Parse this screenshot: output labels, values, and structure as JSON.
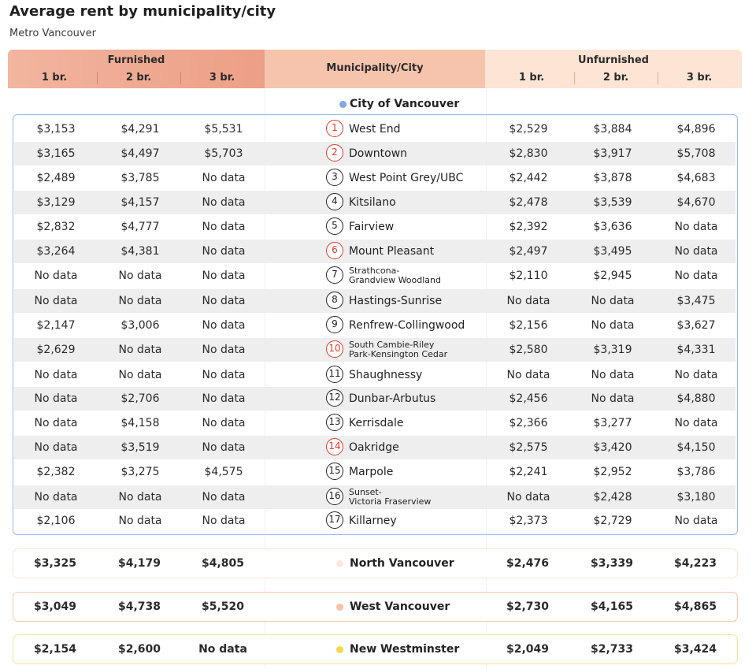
{
  "title": "Average rent by municipality/city",
  "subtitle": "Metro Vancouver",
  "header": {
    "furnished": "Furnished",
    "municipality": "Municipality/City",
    "unfurnished": "Unfurnished",
    "br1": "1 br.",
    "br2": "2 br.",
    "br3": "3 br."
  },
  "city_group": {
    "name": "City of Vancouver",
    "dot_color": "#7fa6f0"
  },
  "rows": [
    {
      "num": "1",
      "red": true,
      "name": "West End",
      "f1": "$3,153",
      "f2": "$4,291",
      "f3": "$5,531",
      "u1": "$2,529",
      "u2": "$3,884",
      "u3": "$4,896"
    },
    {
      "num": "2",
      "red": true,
      "name": "Downtown",
      "f1": "$3,165",
      "f2": "$4,497",
      "f3": "$5,703",
      "u1": "$2,830",
      "u2": "$3,917",
      "u3": "$5,708"
    },
    {
      "num": "3",
      "red": false,
      "name": "West Point Grey/UBC",
      "f1": "$2,489",
      "f2": "$3,785",
      "f3": "No data",
      "u1": "$2,442",
      "u2": "$3,878",
      "u3": "$4,683"
    },
    {
      "num": "4",
      "red": false,
      "name": "Kitsilano",
      "f1": "$3,129",
      "f2": "$4,157",
      "f3": "No data",
      "u1": "$2,478",
      "u2": "$3,539",
      "u3": "$4,670"
    },
    {
      "num": "5",
      "red": false,
      "name": "Fairview",
      "f1": "$2,832",
      "f2": "$4,777",
      "f3": "No data",
      "u1": "$2,392",
      "u2": "$3,636",
      "u3": "No data"
    },
    {
      "num": "6",
      "red": true,
      "name": "Mount Pleasant",
      "f1": "$3,264",
      "f2": "$4,381",
      "f3": "No data",
      "u1": "$2,497",
      "u2": "$3,495",
      "u3": "No data"
    },
    {
      "num": "7",
      "red": false,
      "name": "Strathcona-",
      "name2": "Grandview Woodland",
      "f1": "No data",
      "f2": "No data",
      "f3": "No data",
      "u1": "$2,110",
      "u2": "$2,945",
      "u3": "No data"
    },
    {
      "num": "8",
      "red": false,
      "name": "Hastings-Sunrise",
      "f1": "No data",
      "f2": "No data",
      "f3": "No data",
      "u1": "No data",
      "u2": "No data",
      "u3": "$3,475"
    },
    {
      "num": "9",
      "red": false,
      "name": "Renfrew-Collingwood",
      "f1": "$2,147",
      "f2": "$3,006",
      "f3": "No data",
      "u1": "$2,156",
      "u2": "No data",
      "u3": "$3,627"
    },
    {
      "num": "10",
      "red": true,
      "name": "South Cambie-Riley",
      "name2": "Park-Kensington Cedar",
      "f1": "$2,629",
      "f2": "No data",
      "f3": "No data",
      "u1": "$2,580",
      "u2": "$3,319",
      "u3": "$4,331"
    },
    {
      "num": "11",
      "red": false,
      "name": "Shaughnessy",
      "f1": "No data",
      "f2": "No data",
      "f3": "No data",
      "u1": "No data",
      "u2": "No data",
      "u3": "No data"
    },
    {
      "num": "12",
      "red": false,
      "name": "Dunbar-Arbutus",
      "f1": "No data",
      "f2": "$2,706",
      "f3": "No data",
      "u1": "$2,456",
      "u2": "No data",
      "u3": "$4,880"
    },
    {
      "num": "13",
      "red": false,
      "name": "Kerrisdale",
      "f1": "No data",
      "f2": "$4,158",
      "f3": "No data",
      "u1": "$2,366",
      "u2": "$3,277",
      "u3": "No data"
    },
    {
      "num": "14",
      "red": true,
      "name": "Oakridge",
      "f1": "No data",
      "f2": "$3,519",
      "f3": "No data",
      "u1": "$2,575",
      "u2": "$3,420",
      "u3": "$4,150"
    },
    {
      "num": "15",
      "red": false,
      "name": "Marpole",
      "f1": "$2,382",
      "f2": "$3,275",
      "f3": "$4,575",
      "u1": "$2,241",
      "u2": "$2,952",
      "u3": "$3,786"
    },
    {
      "num": "16",
      "red": false,
      "name": "Sunset-",
      "name2": "Victoria Fraserview",
      "f1": "No data",
      "f2": "No data",
      "f3": "No data",
      "u1": "No data",
      "u2": "$2,428",
      "u3": "$3,180"
    },
    {
      "num": "17",
      "red": false,
      "name": "Killarney",
      "f1": "$2,106",
      "f2": "No data",
      "f3": "No data",
      "u1": "$2,373",
      "u2": "$2,729",
      "u3": "No data"
    }
  ],
  "summaries": [
    {
      "name": "North Vancouver",
      "dot_color": "#fde7d8",
      "border_color": "#fbe3d4",
      "f1": "$3,325",
      "f2": "$4,179",
      "f3": "$4,805",
      "u1": "$2,476",
      "u2": "$3,339",
      "u3": "$4,223"
    },
    {
      "name": "West Vancouver",
      "dot_color": "#f7c3a3",
      "border_color": "#f6c7ab",
      "f1": "$3,049",
      "f2": "$4,738",
      "f3": "$5,520",
      "u1": "$2,730",
      "u2": "$4,165",
      "u3": "$4,865"
    },
    {
      "name": "New Westminster",
      "dot_color": "#f7d74a",
      "border_color": "#f5e39a",
      "f1": "$2,154",
      "f2": "$2,600",
      "f3": "No data",
      "u1": "$2,049",
      "u2": "$2,733",
      "u3": "$3,424"
    }
  ]
}
